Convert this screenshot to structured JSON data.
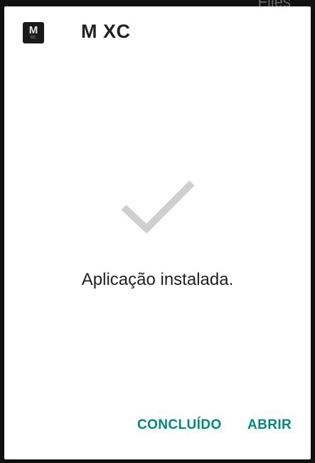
{
  "backdrop": {
    "peek_text": "Files"
  },
  "dialog": {
    "app_icon": {
      "letter": "M",
      "sub": "XC"
    },
    "app_title": "M XC",
    "check_icon": "checkmark-icon",
    "message": "Aplicação instalada.",
    "buttons": {
      "done_label": "CONCLUÍDO",
      "open_label": "ABRIR"
    }
  },
  "colors": {
    "accent": "#00897b",
    "check": "#cfcfcf",
    "text": "#212121"
  }
}
